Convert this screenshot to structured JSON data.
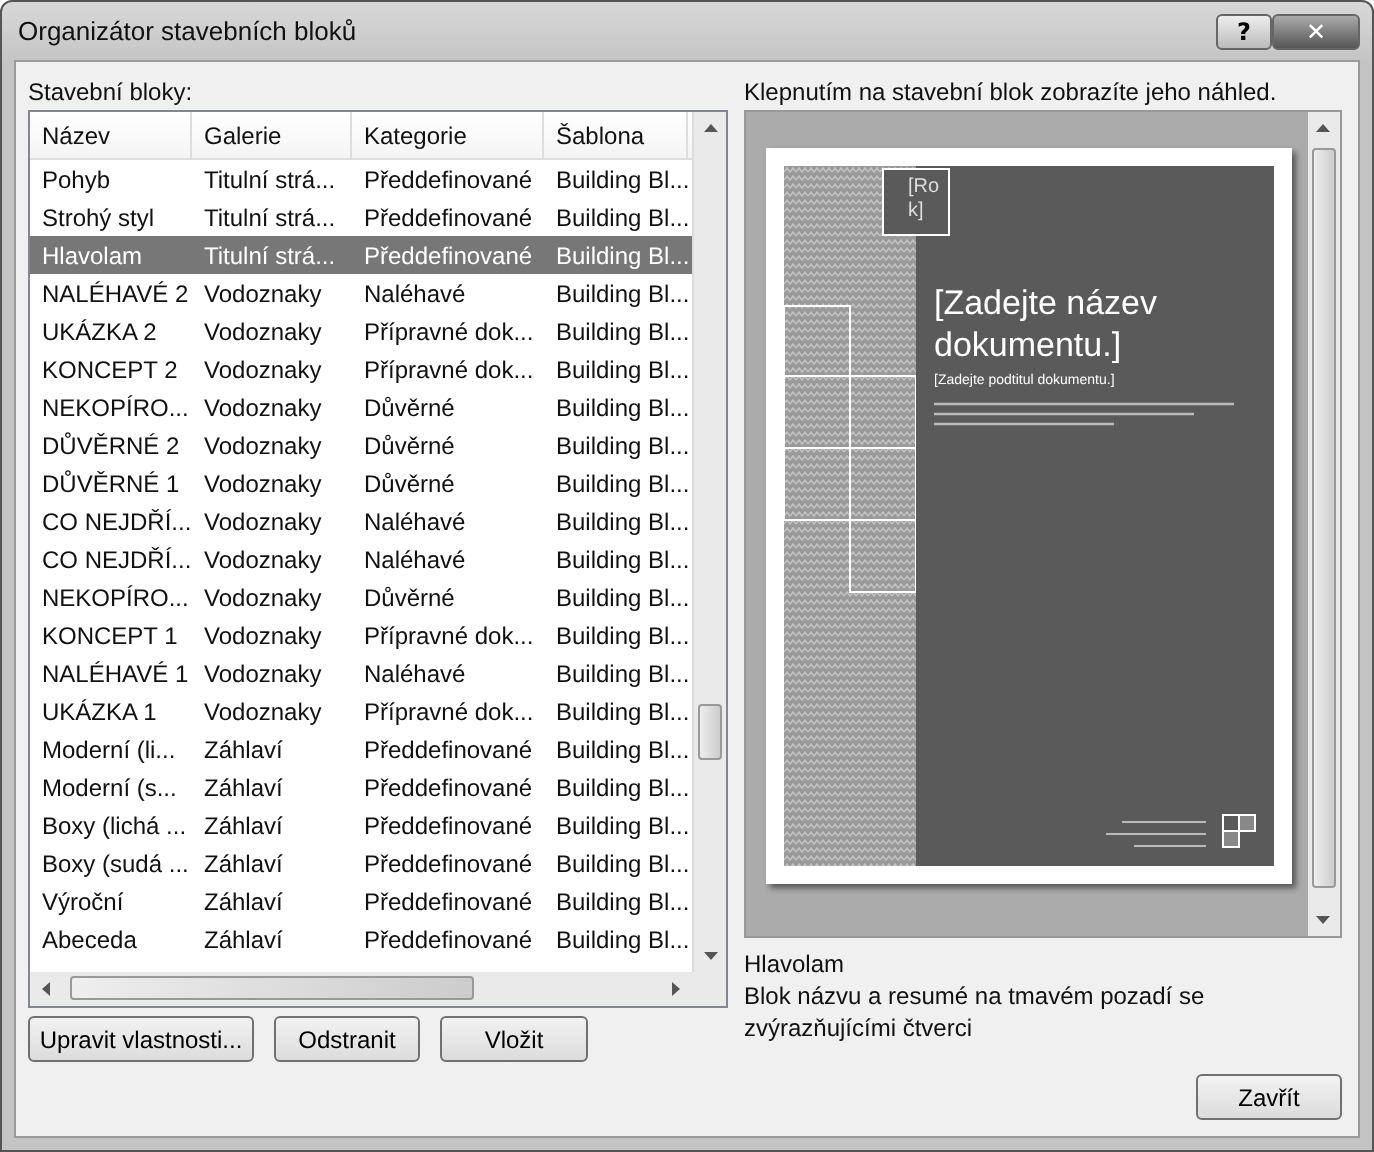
{
  "window": {
    "title": "Organizátor stavebních bloků",
    "help_button": "?",
    "close_button": "✕"
  },
  "list": {
    "label": "Stavební bloky:",
    "columns": [
      "Název",
      "Galerie",
      "Kategorie",
      "Šablona"
    ],
    "rows": [
      {
        "cells": [
          "Pohyb",
          "Titulní strá...",
          "Předdefinované",
          "Building Bl..."
        ],
        "selected": false
      },
      {
        "cells": [
          "Strohý styl",
          "Titulní strá...",
          "Předdefinované",
          "Building Bl..."
        ],
        "selected": false
      },
      {
        "cells": [
          "Hlavolam",
          "Titulní strá...",
          "Předdefinované",
          "Building Bl..."
        ],
        "selected": true
      },
      {
        "cells": [
          "NALÉHAVÉ 2",
          "Vodoznaky",
          "Naléhavé",
          "Building Bl..."
        ],
        "selected": false
      },
      {
        "cells": [
          "UKÁZKA 2",
          "Vodoznaky",
          "Přípravné dok...",
          "Building Bl..."
        ],
        "selected": false
      },
      {
        "cells": [
          "KONCEPT 2",
          "Vodoznaky",
          "Přípravné dok...",
          "Building Bl..."
        ],
        "selected": false
      },
      {
        "cells": [
          "NEKOPÍRO...",
          "Vodoznaky",
          "Důvěrné",
          "Building Bl..."
        ],
        "selected": false
      },
      {
        "cells": [
          "DŮVĚRNÉ 2",
          "Vodoznaky",
          "Důvěrné",
          "Building Bl..."
        ],
        "selected": false
      },
      {
        "cells": [
          "DŮVĚRNÉ 1",
          "Vodoznaky",
          "Důvěrné",
          "Building Bl..."
        ],
        "selected": false
      },
      {
        "cells": [
          "CO NEJDŘÍ...",
          "Vodoznaky",
          "Naléhavé",
          "Building Bl..."
        ],
        "selected": false
      },
      {
        "cells": [
          "CO NEJDŘÍ...",
          "Vodoznaky",
          "Naléhavé",
          "Building Bl..."
        ],
        "selected": false
      },
      {
        "cells": [
          "NEKOPÍRO...",
          "Vodoznaky",
          "Důvěrné",
          "Building Bl..."
        ],
        "selected": false
      },
      {
        "cells": [
          "KONCEPT 1",
          "Vodoznaky",
          "Přípravné dok...",
          "Building Bl..."
        ],
        "selected": false
      },
      {
        "cells": [
          "NALÉHAVÉ 1",
          "Vodoznaky",
          "Naléhavé",
          "Building Bl..."
        ],
        "selected": false
      },
      {
        "cells": [
          "UKÁZKA 1",
          "Vodoznaky",
          "Přípravné dok...",
          "Building Bl..."
        ],
        "selected": false
      },
      {
        "cells": [
          "Moderní (li...",
          "Záhlaví",
          "Předdefinované",
          "Building Bl..."
        ],
        "selected": false
      },
      {
        "cells": [
          "Moderní (s...",
          "Záhlaví",
          "Předdefinované",
          "Building Bl..."
        ],
        "selected": false
      },
      {
        "cells": [
          "Boxy (lichá ...",
          "Záhlaví",
          "Předdefinované",
          "Building Bl..."
        ],
        "selected": false
      },
      {
        "cells": [
          "Boxy (sudá ...",
          "Záhlaví",
          "Předdefinované",
          "Building Bl..."
        ],
        "selected": false
      },
      {
        "cells": [
          "Výroční",
          "Záhlaví",
          "Předdefinované",
          "Building Bl..."
        ],
        "selected": false
      },
      {
        "cells": [
          "Abeceda",
          "Záhlaví",
          "Předdefinované",
          "Building Bl..."
        ],
        "selected": false
      }
    ]
  },
  "list_buttons": [
    "Upravit vlastnosti...",
    "Odstranit",
    "Vložit"
  ],
  "preview": {
    "hint": "Klepnutím na stavební blok zobrazíte jeho náhled.",
    "year": "[Rok]",
    "doc_title": "[Zadejte název dokumentu.]",
    "doc_subtitle": "[Zadejte podtitul dokumentu.]",
    "name": "Hlavolam",
    "description": "Blok názvu a resumé na tmavém pozadí se zvýrazňujícími čtverci"
  },
  "close_label": "Zavřít"
}
